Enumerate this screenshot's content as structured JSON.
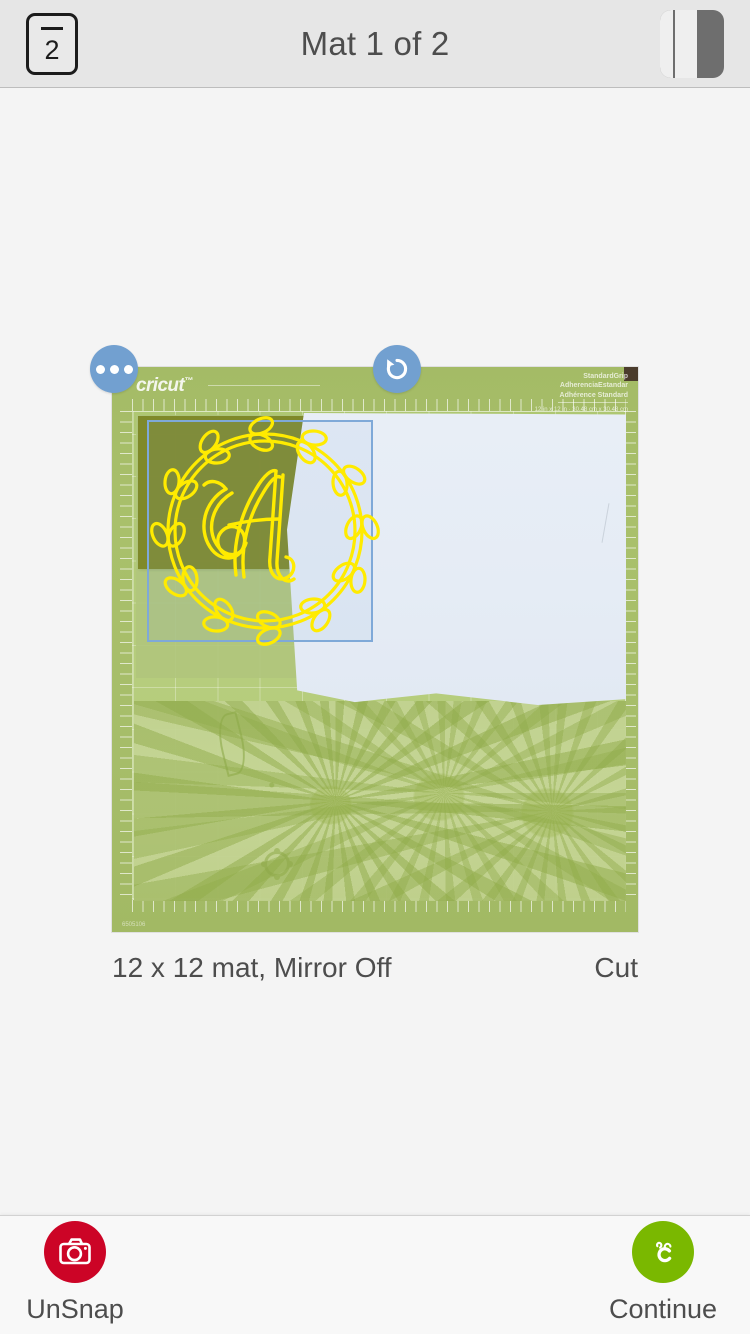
{
  "header": {
    "title": "Mat 1 of 2",
    "mat_count_button": {
      "icon": "mat-stack-icon",
      "value": "2"
    },
    "panel_toggle_button": {
      "icon": "panel-layout-icon",
      "label": "Panel"
    }
  },
  "canvas": {
    "mat_preview": {
      "alt": "Cricut StandardGrip 12 x 12 cutting mat with olive cardstock, white paper and green floral patterned paper",
      "brand_logo": "cricut",
      "grip_line_1": "StandardGrip",
      "grip_line_2": "AdherenciaEstandar",
      "grip_line_3": "Adhérence Standard",
      "grip_dims": "12 in x 12 in · 30.48 cm x 30.48 cm",
      "serial": "6505106",
      "more_button": {
        "icon": "more-dots-icon",
        "label": "More options"
      },
      "rotate_button": {
        "icon": "rotate-ccw-icon",
        "label": "Rotate"
      },
      "design": {
        "name": "monogram-wreath-a",
        "letter": "A",
        "stroke_color": "#ffeb00",
        "selected": true,
        "selection_color": "#7fa9d8"
      }
    },
    "caption": {
      "mat_info": "12 x 12 mat, Mirror Off",
      "operation": "Cut"
    }
  },
  "bottombar": {
    "unsnap": {
      "label": "UnSnap",
      "icon": "camera-icon",
      "color": "#cc0426"
    },
    "continue": {
      "label": "Continue",
      "icon": "cricut-logo-icon",
      "color": "#7ab800"
    }
  }
}
